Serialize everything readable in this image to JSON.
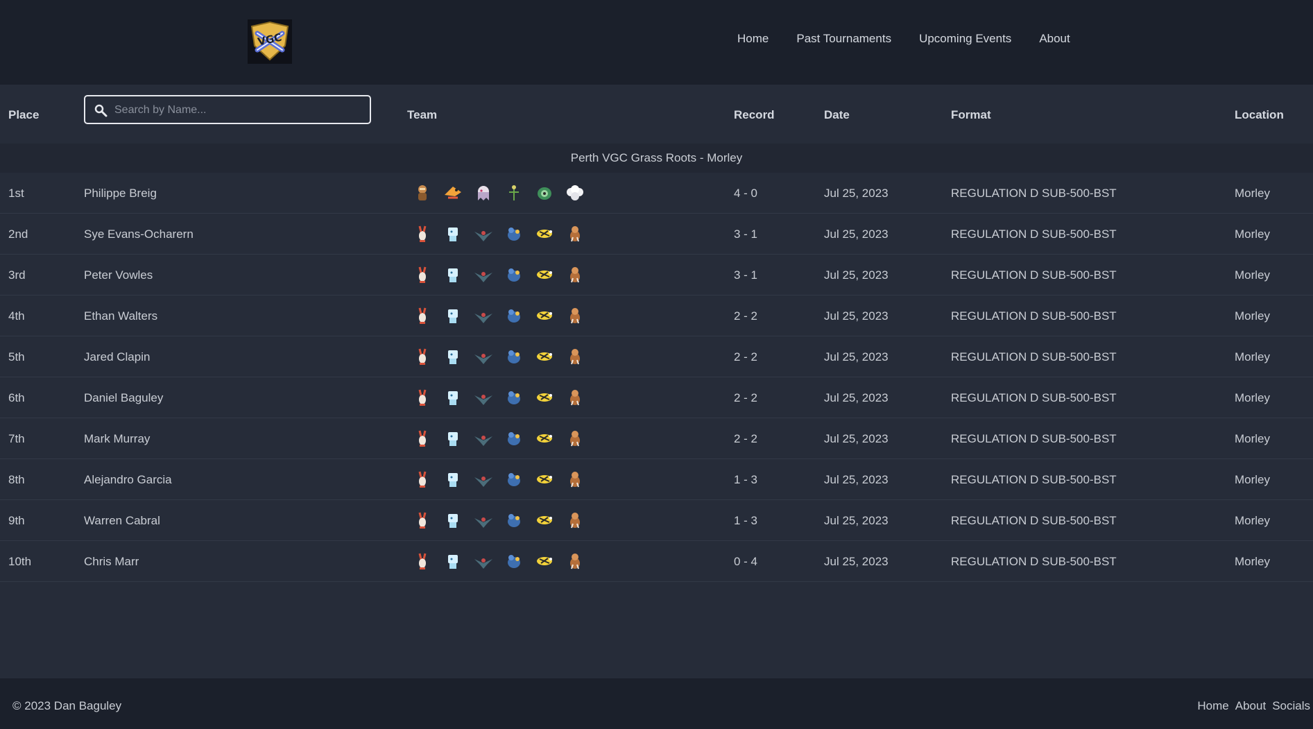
{
  "nav": {
    "links": [
      "Home",
      "Past Tournaments",
      "Upcoming Events",
      "About"
    ]
  },
  "logo": {
    "text": "VGC"
  },
  "table": {
    "headers": {
      "place": "Place",
      "team": "Team",
      "record": "Record",
      "date": "Date",
      "format": "Format",
      "location": "Location"
    },
    "search_placeholder": "Search by Name...",
    "group_title": "Perth VGC Grass Roots - Morley",
    "rows": [
      {
        "place": "1st",
        "name": "Philippe Breig",
        "record": "4 - 0",
        "date": "Jul 25, 2023",
        "format": "REGULATION D SUB-500-BST",
        "location": "Morley",
        "team": [
          "brown-fighter",
          "orange-bird",
          "pink-ghost",
          "green-stick",
          "green-shell",
          "white-cloud"
        ]
      },
      {
        "place": "2nd",
        "name": "Sye Evans-Ocharern",
        "record": "3 - 1",
        "date": "Jul 25, 2023",
        "format": "REGULATION D SUB-500-BST",
        "location": "Morley",
        "team": [
          "red-rabbit",
          "ice-block",
          "steel-bird",
          "blue-dragon",
          "yellow-bee",
          "brown-beast"
        ]
      },
      {
        "place": "3rd",
        "name": "Peter Vowles",
        "record": "3 - 1",
        "date": "Jul 25, 2023",
        "format": "REGULATION D SUB-500-BST",
        "location": "Morley",
        "team": [
          "red-rabbit",
          "ice-block",
          "steel-bird",
          "blue-dragon",
          "yellow-bee",
          "brown-beast"
        ]
      },
      {
        "place": "4th",
        "name": "Ethan Walters",
        "record": "2 - 2",
        "date": "Jul 25, 2023",
        "format": "REGULATION D SUB-500-BST",
        "location": "Morley",
        "team": [
          "red-rabbit",
          "ice-block",
          "steel-bird",
          "blue-dragon",
          "yellow-bee",
          "brown-beast"
        ]
      },
      {
        "place": "5th",
        "name": "Jared Clapin",
        "record": "2 - 2",
        "date": "Jul 25, 2023",
        "format": "REGULATION D SUB-500-BST",
        "location": "Morley",
        "team": [
          "red-rabbit",
          "ice-block",
          "steel-bird",
          "blue-dragon",
          "yellow-bee",
          "brown-beast"
        ]
      },
      {
        "place": "6th",
        "name": "Daniel Baguley",
        "record": "2 - 2",
        "date": "Jul 25, 2023",
        "format": "REGULATION D SUB-500-BST",
        "location": "Morley",
        "team": [
          "red-rabbit",
          "ice-block",
          "steel-bird",
          "blue-dragon",
          "yellow-bee",
          "brown-beast"
        ]
      },
      {
        "place": "7th",
        "name": "Mark Murray",
        "record": "2 - 2",
        "date": "Jul 25, 2023",
        "format": "REGULATION D SUB-500-BST",
        "location": "Morley",
        "team": [
          "red-rabbit",
          "ice-block",
          "steel-bird",
          "blue-dragon",
          "yellow-bee",
          "brown-beast"
        ]
      },
      {
        "place": "8th",
        "name": "Alejandro Garcia",
        "record": "1 - 3",
        "date": "Jul 25, 2023",
        "format": "REGULATION D SUB-500-BST",
        "location": "Morley",
        "team": [
          "red-rabbit",
          "ice-block",
          "steel-bird",
          "blue-dragon",
          "yellow-bee",
          "brown-beast"
        ]
      },
      {
        "place": "9th",
        "name": "Warren Cabral",
        "record": "1 - 3",
        "date": "Jul 25, 2023",
        "format": "REGULATION D SUB-500-BST",
        "location": "Morley",
        "team": [
          "red-rabbit",
          "ice-block",
          "steel-bird",
          "blue-dragon",
          "yellow-bee",
          "brown-beast"
        ]
      },
      {
        "place": "10th",
        "name": "Chris Marr",
        "record": "0 - 4",
        "date": "Jul 25, 2023",
        "format": "REGULATION D SUB-500-BST",
        "location": "Morley",
        "team": [
          "red-rabbit",
          "ice-block",
          "steel-bird",
          "blue-dragon",
          "yellow-bee",
          "brown-beast"
        ]
      }
    ]
  },
  "footer": {
    "copyright": "© 2023 Dan Baguley",
    "links": [
      "Home",
      "About",
      "Socials"
    ]
  },
  "colors": {
    "page_bg": "#262c39",
    "header_bg": "#1b202b",
    "group_bg": "#222733",
    "text": "#c9cdd4"
  }
}
